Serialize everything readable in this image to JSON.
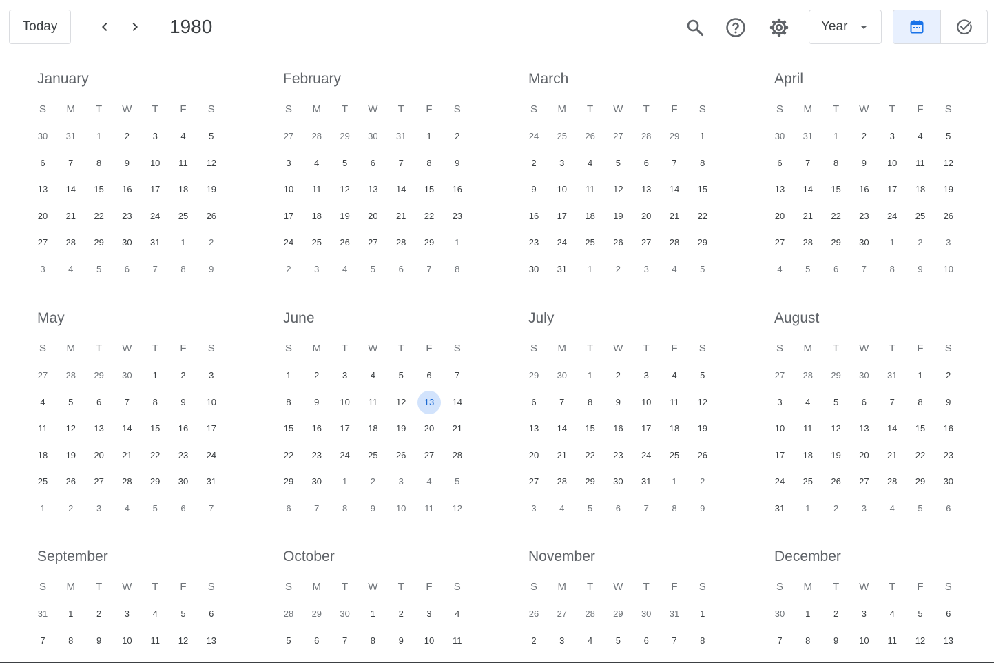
{
  "header": {
    "today_label": "Today",
    "year": "1980",
    "view_label": "Year",
    "accent_color": "#1a73e8",
    "icons": [
      "chevron-left-icon",
      "chevron-right-icon",
      "search-icon",
      "help-icon",
      "settings-icon",
      "calendar-icon",
      "task-check-icon"
    ]
  },
  "weekday_labels": [
    "S",
    "M",
    "T",
    "W",
    "T",
    "F",
    "S"
  ],
  "today": {
    "month": "June",
    "day": "13"
  },
  "months": [
    {
      "name": "January",
      "weeks": [
        [
          "30",
          "31",
          "1",
          "2",
          "3",
          "4",
          "5"
        ],
        [
          "6",
          "7",
          "8",
          "9",
          "10",
          "11",
          "12"
        ],
        [
          "13",
          "14",
          "15",
          "16",
          "17",
          "18",
          "19"
        ],
        [
          "20",
          "21",
          "22",
          "23",
          "24",
          "25",
          "26"
        ],
        [
          "27",
          "28",
          "29",
          "30",
          "31",
          "1",
          "2"
        ],
        [
          "3",
          "4",
          "5",
          "6",
          "7",
          "8",
          "9"
        ]
      ],
      "lead_other": 2
    },
    {
      "name": "February",
      "weeks": [
        [
          "27",
          "28",
          "29",
          "30",
          "31",
          "1",
          "2"
        ],
        [
          "3",
          "4",
          "5",
          "6",
          "7",
          "8",
          "9"
        ],
        [
          "10",
          "11",
          "12",
          "13",
          "14",
          "15",
          "16"
        ],
        [
          "17",
          "18",
          "19",
          "20",
          "21",
          "22",
          "23"
        ],
        [
          "24",
          "25",
          "26",
          "27",
          "28",
          "29",
          "1"
        ],
        [
          "2",
          "3",
          "4",
          "5",
          "6",
          "7",
          "8"
        ]
      ],
      "lead_other": 5
    },
    {
      "name": "March",
      "weeks": [
        [
          "24",
          "25",
          "26",
          "27",
          "28",
          "29",
          "1"
        ],
        [
          "2",
          "3",
          "4",
          "5",
          "6",
          "7",
          "8"
        ],
        [
          "9",
          "10",
          "11",
          "12",
          "13",
          "14",
          "15"
        ],
        [
          "16",
          "17",
          "18",
          "19",
          "20",
          "21",
          "22"
        ],
        [
          "23",
          "24",
          "25",
          "26",
          "27",
          "28",
          "29"
        ],
        [
          "30",
          "31",
          "1",
          "2",
          "3",
          "4",
          "5"
        ]
      ],
      "lead_other": 6
    },
    {
      "name": "April",
      "weeks": [
        [
          "30",
          "31",
          "1",
          "2",
          "3",
          "4",
          "5"
        ],
        [
          "6",
          "7",
          "8",
          "9",
          "10",
          "11",
          "12"
        ],
        [
          "13",
          "14",
          "15",
          "16",
          "17",
          "18",
          "19"
        ],
        [
          "20",
          "21",
          "22",
          "23",
          "24",
          "25",
          "26"
        ],
        [
          "27",
          "28",
          "29",
          "30",
          "1",
          "2",
          "3"
        ],
        [
          "4",
          "5",
          "6",
          "7",
          "8",
          "9",
          "10"
        ]
      ],
      "lead_other": 2
    },
    {
      "name": "May",
      "weeks": [
        [
          "27",
          "28",
          "29",
          "30",
          "1",
          "2",
          "3"
        ],
        [
          "4",
          "5",
          "6",
          "7",
          "8",
          "9",
          "10"
        ],
        [
          "11",
          "12",
          "13",
          "14",
          "15",
          "16",
          "17"
        ],
        [
          "18",
          "19",
          "20",
          "21",
          "22",
          "23",
          "24"
        ],
        [
          "25",
          "26",
          "27",
          "28",
          "29",
          "30",
          "31"
        ],
        [
          "1",
          "2",
          "3",
          "4",
          "5",
          "6",
          "7"
        ]
      ],
      "lead_other": 4
    },
    {
      "name": "June",
      "weeks": [
        [
          "1",
          "2",
          "3",
          "4",
          "5",
          "6",
          "7"
        ],
        [
          "8",
          "9",
          "10",
          "11",
          "12",
          "13",
          "14"
        ],
        [
          "15",
          "16",
          "17",
          "18",
          "19",
          "20",
          "21"
        ],
        [
          "22",
          "23",
          "24",
          "25",
          "26",
          "27",
          "28"
        ],
        [
          "29",
          "30",
          "1",
          "2",
          "3",
          "4",
          "5"
        ],
        [
          "6",
          "7",
          "8",
          "9",
          "10",
          "11",
          "12"
        ]
      ],
      "lead_other": 0
    },
    {
      "name": "July",
      "weeks": [
        [
          "29",
          "30",
          "1",
          "2",
          "3",
          "4",
          "5"
        ],
        [
          "6",
          "7",
          "8",
          "9",
          "10",
          "11",
          "12"
        ],
        [
          "13",
          "14",
          "15",
          "16",
          "17",
          "18",
          "19"
        ],
        [
          "20",
          "21",
          "22",
          "23",
          "24",
          "25",
          "26"
        ],
        [
          "27",
          "28",
          "29",
          "30",
          "31",
          "1",
          "2"
        ],
        [
          "3",
          "4",
          "5",
          "6",
          "7",
          "8",
          "9"
        ]
      ],
      "lead_other": 2
    },
    {
      "name": "August",
      "weeks": [
        [
          "27",
          "28",
          "29",
          "30",
          "31",
          "1",
          "2"
        ],
        [
          "3",
          "4",
          "5",
          "6",
          "7",
          "8",
          "9"
        ],
        [
          "10",
          "11",
          "12",
          "13",
          "14",
          "15",
          "16"
        ],
        [
          "17",
          "18",
          "19",
          "20",
          "21",
          "22",
          "23"
        ],
        [
          "24",
          "25",
          "26",
          "27",
          "28",
          "29",
          "30"
        ],
        [
          "31",
          "1",
          "2",
          "3",
          "4",
          "5",
          "6"
        ]
      ],
      "lead_other": 5
    },
    {
      "name": "September",
      "weeks": [
        [
          "31",
          "1",
          "2",
          "3",
          "4",
          "5",
          "6"
        ],
        [
          "7",
          "8",
          "9",
          "10",
          "11",
          "12",
          "13"
        ]
      ],
      "lead_other": 1
    },
    {
      "name": "October",
      "weeks": [
        [
          "28",
          "29",
          "30",
          "1",
          "2",
          "3",
          "4"
        ],
        [
          "5",
          "6",
          "7",
          "8",
          "9",
          "10",
          "11"
        ]
      ],
      "lead_other": 3
    },
    {
      "name": "November",
      "weeks": [
        [
          "26",
          "27",
          "28",
          "29",
          "30",
          "31",
          "1"
        ],
        [
          "2",
          "3",
          "4",
          "5",
          "6",
          "7",
          "8"
        ]
      ],
      "lead_other": 6
    },
    {
      "name": "December",
      "weeks": [
        [
          "30",
          "1",
          "2",
          "3",
          "4",
          "5",
          "6"
        ],
        [
          "7",
          "8",
          "9",
          "10",
          "11",
          "12",
          "13"
        ]
      ],
      "lead_other": 1
    }
  ]
}
